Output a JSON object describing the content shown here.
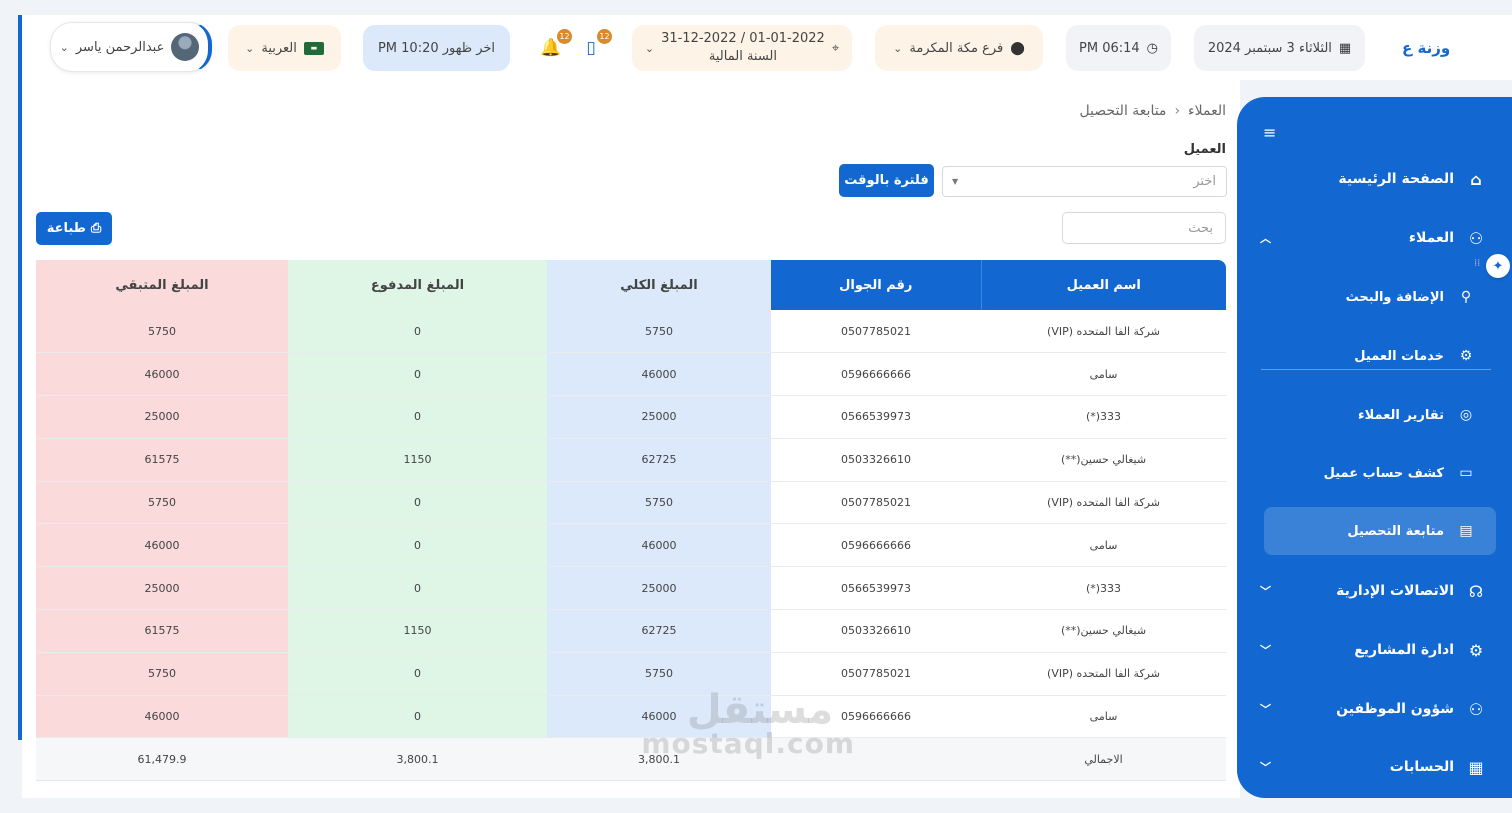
{
  "topbar": {
    "logo": "وزنة ع",
    "date": "الثلاثاء 3 سبتمبر 2024",
    "time": "PM 06:14",
    "branch": "فرع مكة المكرمة",
    "fiscal_range": "01-01-2022 / 31-12-2022",
    "fiscal_label": "السنة المالية",
    "notif_count_1": "12",
    "notif_count_2": "12",
    "last_seen": "اخر ظهور PM 10:20",
    "language": "العربية",
    "user_name": "عبدالرحمن ياسر"
  },
  "sidebar": {
    "items": [
      {
        "label": "الصفحة الرئيسية",
        "icon": "home-icon"
      },
      {
        "label": "العملاء",
        "icon": "users-icon"
      },
      {
        "label": "الإضافة والبحث",
        "icon": "search-icon"
      },
      {
        "label": "خدمات العميل",
        "icon": "gear-icon"
      },
      {
        "label": "تقارير العملاء",
        "icon": "user-circle-icon"
      },
      {
        "label": "كشف حساب عميل",
        "icon": "archive-icon"
      },
      {
        "label": "متابعة التحصيل",
        "icon": "clipboard-icon"
      },
      {
        "label": "الاتصالات الإدارية",
        "icon": "headset-icon"
      },
      {
        "label": "ادارة المشاريع",
        "icon": "gear-icon"
      },
      {
        "label": "شؤون الموظفين",
        "icon": "team-icon"
      },
      {
        "label": "الحسابات",
        "icon": "calculator-icon"
      }
    ]
  },
  "breadcrumb": {
    "parent": "العملاء",
    "current": "متابعة التحصيل"
  },
  "filter": {
    "client_label": "العميل",
    "select_placeholder": "اختر",
    "filter_button": "فلترة بالوقت",
    "search_placeholder": "بحث",
    "print_button": "طباعة"
  },
  "table": {
    "headers": {
      "name": "اسم العميل",
      "phone": "رقم الجوال",
      "total": "المبلغ الكلي",
      "paid": "المبلغ المدفوع",
      "remaining": "المبلغ المتبقي"
    },
    "rows": [
      {
        "name": "شركة الفا المتحده (VIP)",
        "phone": "0507785021",
        "total": "5750",
        "paid": "0",
        "remaining": "5750"
      },
      {
        "name": "سامى",
        "phone": "0596666666",
        "total": "46000",
        "paid": "0",
        "remaining": "46000"
      },
      {
        "name": "333(*)",
        "phone": "0566539973",
        "total": "25000",
        "paid": "0",
        "remaining": "25000"
      },
      {
        "name": "شيغالي حسين(**)",
        "phone": "0503326610",
        "total": "62725",
        "paid": "1150",
        "remaining": "61575"
      },
      {
        "name": "شركة الفا المتحده (VIP)",
        "phone": "0507785021",
        "total": "5750",
        "paid": "0",
        "remaining": "5750"
      },
      {
        "name": "سامى",
        "phone": "0596666666",
        "total": "46000",
        "paid": "0",
        "remaining": "46000"
      },
      {
        "name": "333(*)",
        "phone": "0566539973",
        "total": "25000",
        "paid": "0",
        "remaining": "25000"
      },
      {
        "name": "شيغالي حسين(**)",
        "phone": "0503326610",
        "total": "62725",
        "paid": "1150",
        "remaining": "61575"
      },
      {
        "name": "شركة الفا المتحده (VIP)",
        "phone": "0507785021",
        "total": "5750",
        "paid": "0",
        "remaining": "5750"
      },
      {
        "name": "سامى",
        "phone": "0596666666",
        "total": "46000",
        "paid": "0",
        "remaining": "46000"
      }
    ],
    "summary": {
      "label": "الاجمالي",
      "phone": "",
      "total": "3,800.1",
      "paid": "3,800.1",
      "remaining": "61,479.9"
    }
  },
  "watermark": {
    "line1": "مستقل",
    "line2": "mostaql.com"
  },
  "colors": {
    "primary": "#1268d0",
    "total_bg": "#dbe9fb",
    "paid_bg": "#dff5e6",
    "remaining_bg": "#fadada"
  }
}
